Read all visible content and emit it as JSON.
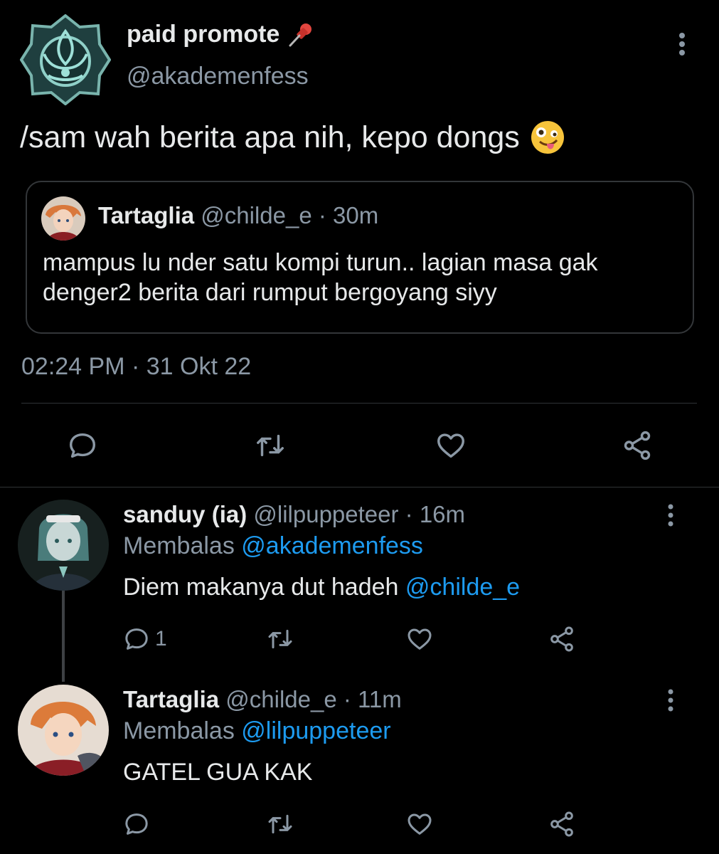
{
  "main_tweet": {
    "display_name": "paid promote",
    "name_emoji": "pushpin-icon",
    "handle": "@akademenfess",
    "text": "/sam wah berita apa nih, kepo dongs",
    "text_emoji": "zany-face-icon",
    "timestamp": "02:24 PM · 31 Okt 22",
    "quote": {
      "name": "Tartaglia",
      "handle": "@childe_e",
      "time": " · 30m",
      "text": "mampus lu nder satu kompi turun.. lagian masa gak denger2 berita dari rumput bergoyang siyy"
    }
  },
  "replies": [
    {
      "name": "sanduy (ia)",
      "handle": "@lilpuppeteer",
      "time": " · 16m",
      "replying_label": "Membalas ",
      "replying_to": "@akademenfess",
      "text": "Diem makanya dut hadeh ",
      "text_mention": "@childe_e",
      "reply_count": "1"
    },
    {
      "name": "Tartaglia",
      "handle": "@childe_e",
      "time": " · 11m",
      "replying_label": "Membalas ",
      "replying_to": "@lilpuppeteer",
      "text": "GATEL GUA KAK",
      "reply_count": ""
    }
  ],
  "colors": {
    "background": "#000000",
    "text_primary": "#e7e9ea",
    "text_secondary": "#8b98a5",
    "link": "#1d9bf0",
    "border": "#2f3336"
  }
}
